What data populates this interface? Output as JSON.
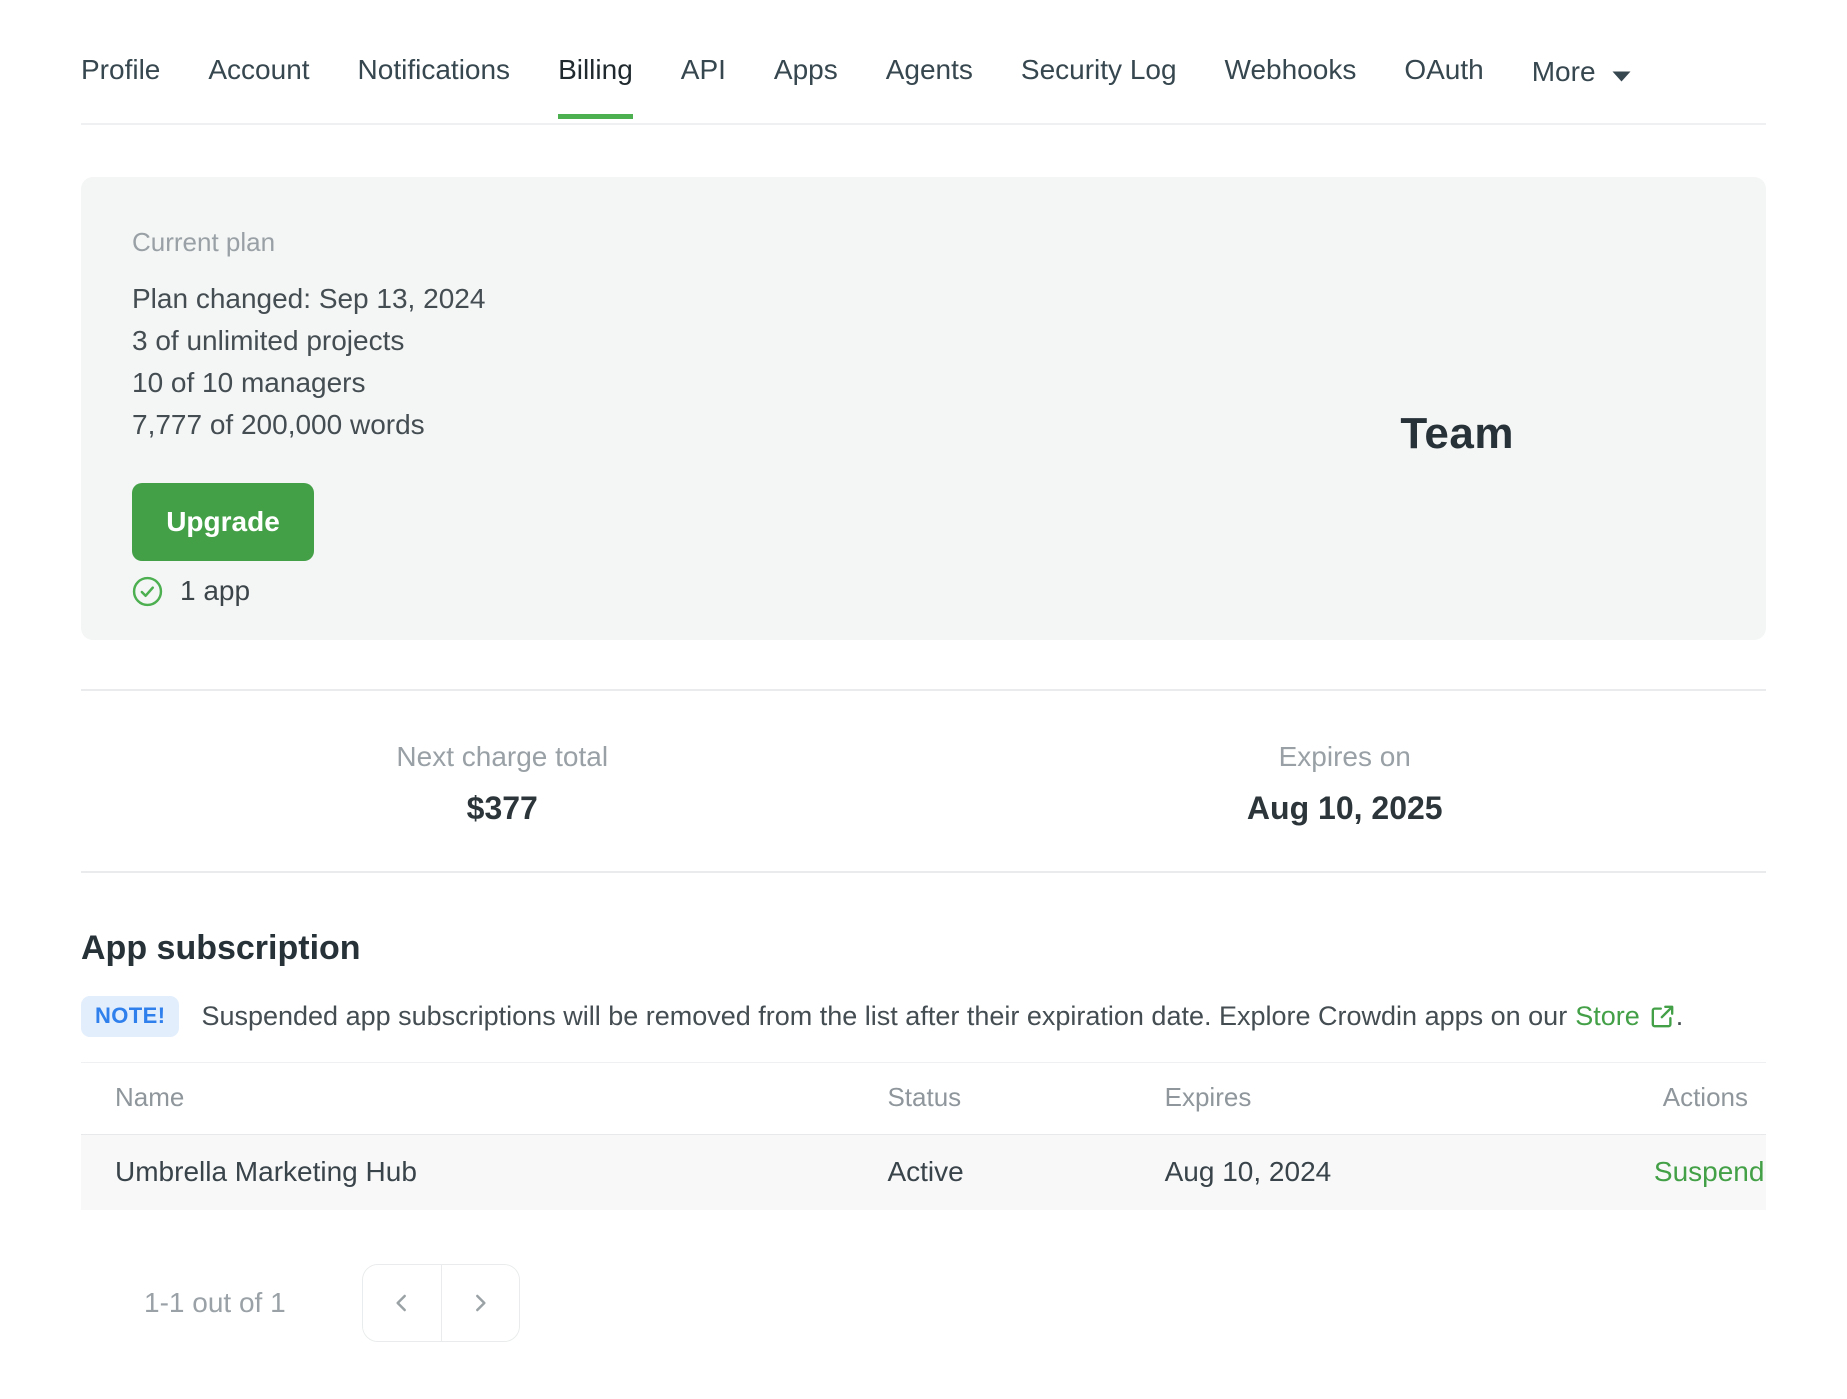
{
  "nav": {
    "tabs": [
      {
        "label": "Profile",
        "active": false
      },
      {
        "label": "Account",
        "active": false
      },
      {
        "label": "Notifications",
        "active": false
      },
      {
        "label": "Billing",
        "active": true
      },
      {
        "label": "API",
        "active": false
      },
      {
        "label": "Apps",
        "active": false
      },
      {
        "label": "Agents",
        "active": false
      },
      {
        "label": "Security Log",
        "active": false
      },
      {
        "label": "Webhooks",
        "active": false
      },
      {
        "label": "OAuth",
        "active": false
      },
      {
        "label": "More",
        "active": false,
        "has_caret": true
      }
    ]
  },
  "plan_card": {
    "label": "Current plan",
    "lines": [
      "Plan changed: Sep 13, 2024",
      "3 of unlimited projects",
      "10 of 10 managers",
      "7,777 of 200,000 words"
    ],
    "upgrade_label": "Upgrade",
    "apps_note": "1 app",
    "plan_name": "Team"
  },
  "billing_summary": {
    "next_charge": {
      "label": "Next charge total",
      "value": "$377"
    },
    "expires": {
      "label": "Expires on",
      "value": "Aug 10, 2025"
    }
  },
  "app_subscription": {
    "title": "App subscription",
    "note_badge": "NOTE!",
    "note_text_before": "Suspended app subscriptions will be removed from the list after their expiration date. Explore Crowdin apps on our",
    "note_link": "Store",
    "note_text_after": ".",
    "table": {
      "headers": [
        "Name",
        "Status",
        "Expires",
        "Actions"
      ],
      "rows": [
        {
          "name": "Umbrella Marketing Hub",
          "status": "Active",
          "expires": "Aug 10, 2024",
          "action": "Suspend"
        }
      ]
    },
    "pagination": {
      "label": "1-1 out of 1"
    }
  },
  "icons": {
    "more_caret": "caret-down",
    "apps_check": "check-circle",
    "store_external": "external-link",
    "pagination_prev": "chevron-left",
    "pagination_next": "chevron-right"
  },
  "colors": {
    "accent_green": "#43a047",
    "underline_green": "#4caf50",
    "card_background": "#f4f5f5",
    "row_background": "#f8f8f8",
    "note_badge_bg": "#e2eefc",
    "note_badge_text": "#2f80ed",
    "muted_text": "#99a1a6",
    "dark_text": "#263238"
  }
}
